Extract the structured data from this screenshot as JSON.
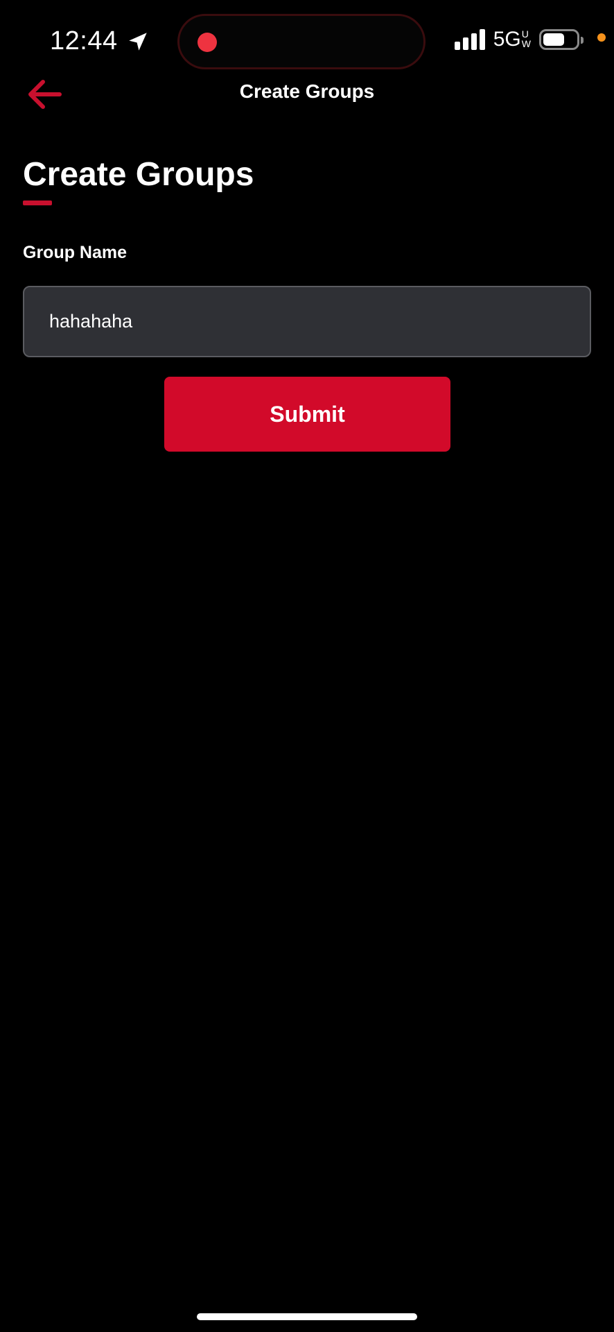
{
  "status_bar": {
    "time": "12:44",
    "network": "5G",
    "network_sup_top": "U",
    "network_sup_bottom": "W",
    "location_icon": "location-arrow-icon",
    "battery_level": 0.66
  },
  "nav": {
    "back_icon": "arrow-left-icon",
    "title": "Create Groups"
  },
  "page": {
    "heading": "Create Groups"
  },
  "form": {
    "group_name_label": "Group Name",
    "group_name_value": "hahahaha",
    "submit_label": "Submit"
  },
  "colors": {
    "background": "#000000",
    "accent": "#d20a2a",
    "input_background": "#2f3035",
    "recording_dot": "#ee3340",
    "privacy_dot": "#f5921c"
  }
}
